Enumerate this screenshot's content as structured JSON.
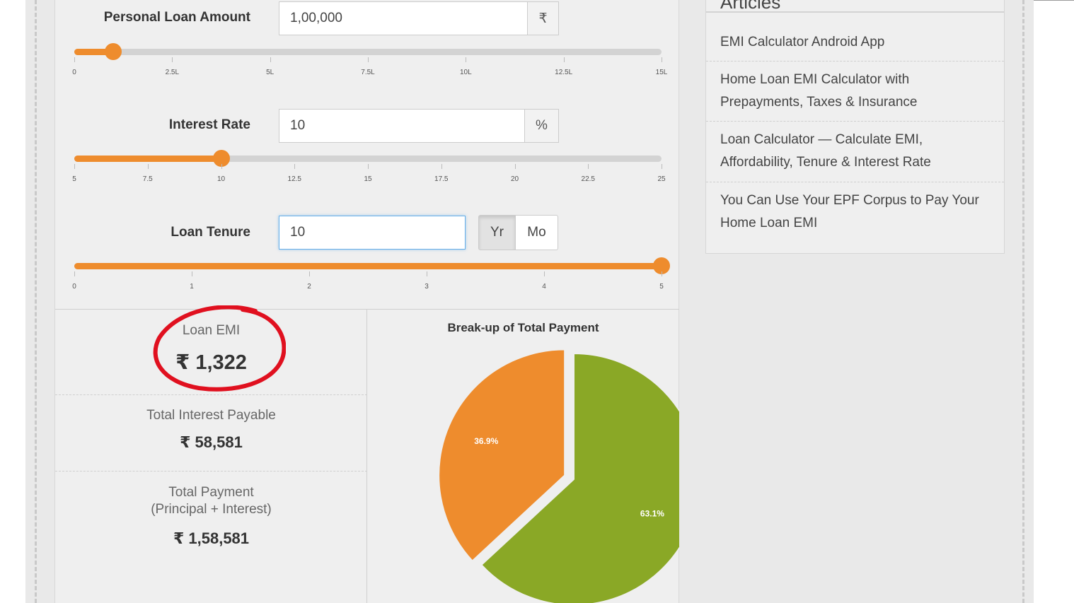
{
  "calculator": {
    "loan_amount": {
      "label": "Personal Loan Amount",
      "value": "1,00,000",
      "unit": "₹",
      "slider_fraction": 0.0667,
      "ticks": [
        "0",
        "2.5L",
        "5L",
        "7.5L",
        "10L",
        "12.5L",
        "15L"
      ]
    },
    "interest_rate": {
      "label": "Interest Rate",
      "value": "10",
      "unit": "%",
      "slider_fraction": 0.25,
      "ticks": [
        "5",
        "7.5",
        "10",
        "12.5",
        "15",
        "17.5",
        "20",
        "22.5",
        "25"
      ]
    },
    "loan_tenure": {
      "label": "Loan Tenure",
      "value": "10",
      "toggle_years": "Yr",
      "toggle_months": "Mo",
      "selected": "Yr",
      "slider_fraction": 1.0,
      "ticks": [
        "0",
        "1",
        "2",
        "3",
        "4",
        "5"
      ]
    }
  },
  "results": {
    "emi": {
      "label": "Loan EMI",
      "value": "₹ 1,322"
    },
    "total_interest": {
      "label": "Total Interest Payable",
      "value": "₹ 58,581"
    },
    "total_payment": {
      "label_line1": "Total Payment",
      "label_line2": "(Principal + Interest)",
      "value": "₹ 1,58,581"
    }
  },
  "chart_data": {
    "type": "pie",
    "title": "Break-up of Total Payment",
    "slices": [
      {
        "label": "36.9%",
        "value": 36.9,
        "color": "#ee8c2d"
      },
      {
        "label": "63.1%",
        "value": 63.1,
        "color": "#8aa826"
      }
    ]
  },
  "articles": {
    "heading": "Articles",
    "items": [
      "EMI Calculator Android App",
      "Home Loan EMI Calculator with Prepayments, Taxes & Insurance",
      "Loan Calculator — Calculate EMI, Affordability, Tenure & Interest Rate",
      "You Can Use Your EPF Corpus to Pay Your Home Loan EMI"
    ]
  },
  "colors": {
    "accent": "#ee8c2d",
    "interest_slice": "#ee8c2d",
    "principal_slice": "#8aa826",
    "annotation": "#e0101f"
  }
}
